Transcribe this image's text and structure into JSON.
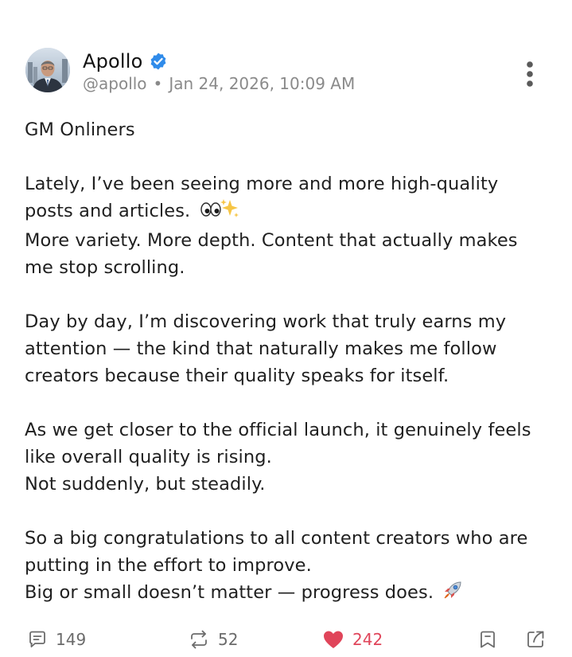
{
  "author": {
    "display_name": "Apollo",
    "handle": "@apollo",
    "timestamp": "Jan 24, 2026, 10:09 AM",
    "verified": true
  },
  "post": {
    "lines": [
      "GM Onliners",
      "",
      "Lately, I’ve been seeing more and more high-quality",
      "posts and articles.",
      "More variety. More depth. Content that actually makes",
      "me stop scrolling.",
      "",
      "Day by day, I’m discovering work that truly earns my",
      "attention — the kind that naturally makes me follow",
      "creators because their quality speaks for itself.",
      "",
      "As we get closer to the official launch, it genuinely feels",
      "like overall quality is rising.",
      "Not suddenly, but steadily.",
      "",
      "So a big congratulations to all content creators who are",
      "putting in the effort to improve.",
      "Big or small doesn’t matter — progress does."
    ],
    "emojis": {
      "articles_line": "👀✨",
      "progress_line": "🚀"
    }
  },
  "actions": {
    "comments": "149",
    "reposts": "52",
    "likes": "242"
  },
  "icons": {
    "comment": "comment-icon",
    "repost": "repost-icon",
    "like": "heart-icon",
    "bookmark": "bookmark-icon",
    "share": "share-icon",
    "more": "more-vertical-icon",
    "verified": "verified-badge-icon"
  },
  "colors": {
    "verified_blue": "#2f8bea",
    "like_red": "#e0455a",
    "muted_text": "#8a8a8a"
  }
}
